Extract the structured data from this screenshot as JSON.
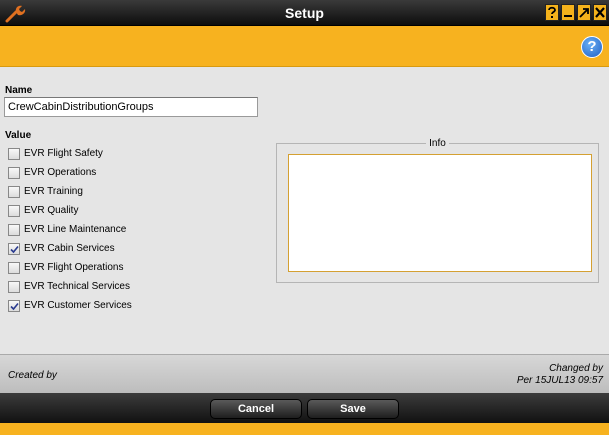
{
  "window": {
    "title": "Setup",
    "buttons": [
      "help",
      "minimize",
      "maximize",
      "close"
    ]
  },
  "header": {
    "help_label": "?"
  },
  "form": {
    "name_label": "Name",
    "name_value": "CrewCabinDistributionGroups",
    "value_label": "Value",
    "items": [
      {
        "label": "EVR Flight Safety",
        "checked": false
      },
      {
        "label": "EVR Operations",
        "checked": false
      },
      {
        "label": "EVR Training",
        "checked": false
      },
      {
        "label": "EVR Quality",
        "checked": false
      },
      {
        "label": "EVR Line Maintenance",
        "checked": false
      },
      {
        "label": "EVR Cabin Services",
        "checked": true
      },
      {
        "label": "EVR Flight Operations",
        "checked": false
      },
      {
        "label": "EVR Technical Services",
        "checked": false
      },
      {
        "label": "EVR Customer Services",
        "checked": true
      }
    ],
    "info_label": "Info",
    "info_value": ""
  },
  "footer": {
    "created_by": "Created by",
    "changed_by": "Changed by",
    "changed_info": "Per 15JUL13 09:57"
  },
  "actions": {
    "cancel_label": "Cancel",
    "save_label": "Save"
  },
  "colors": {
    "accent": "#f7b21f",
    "titlebar": "#1a1a1a",
    "help_icon": "#1f5fc4"
  }
}
